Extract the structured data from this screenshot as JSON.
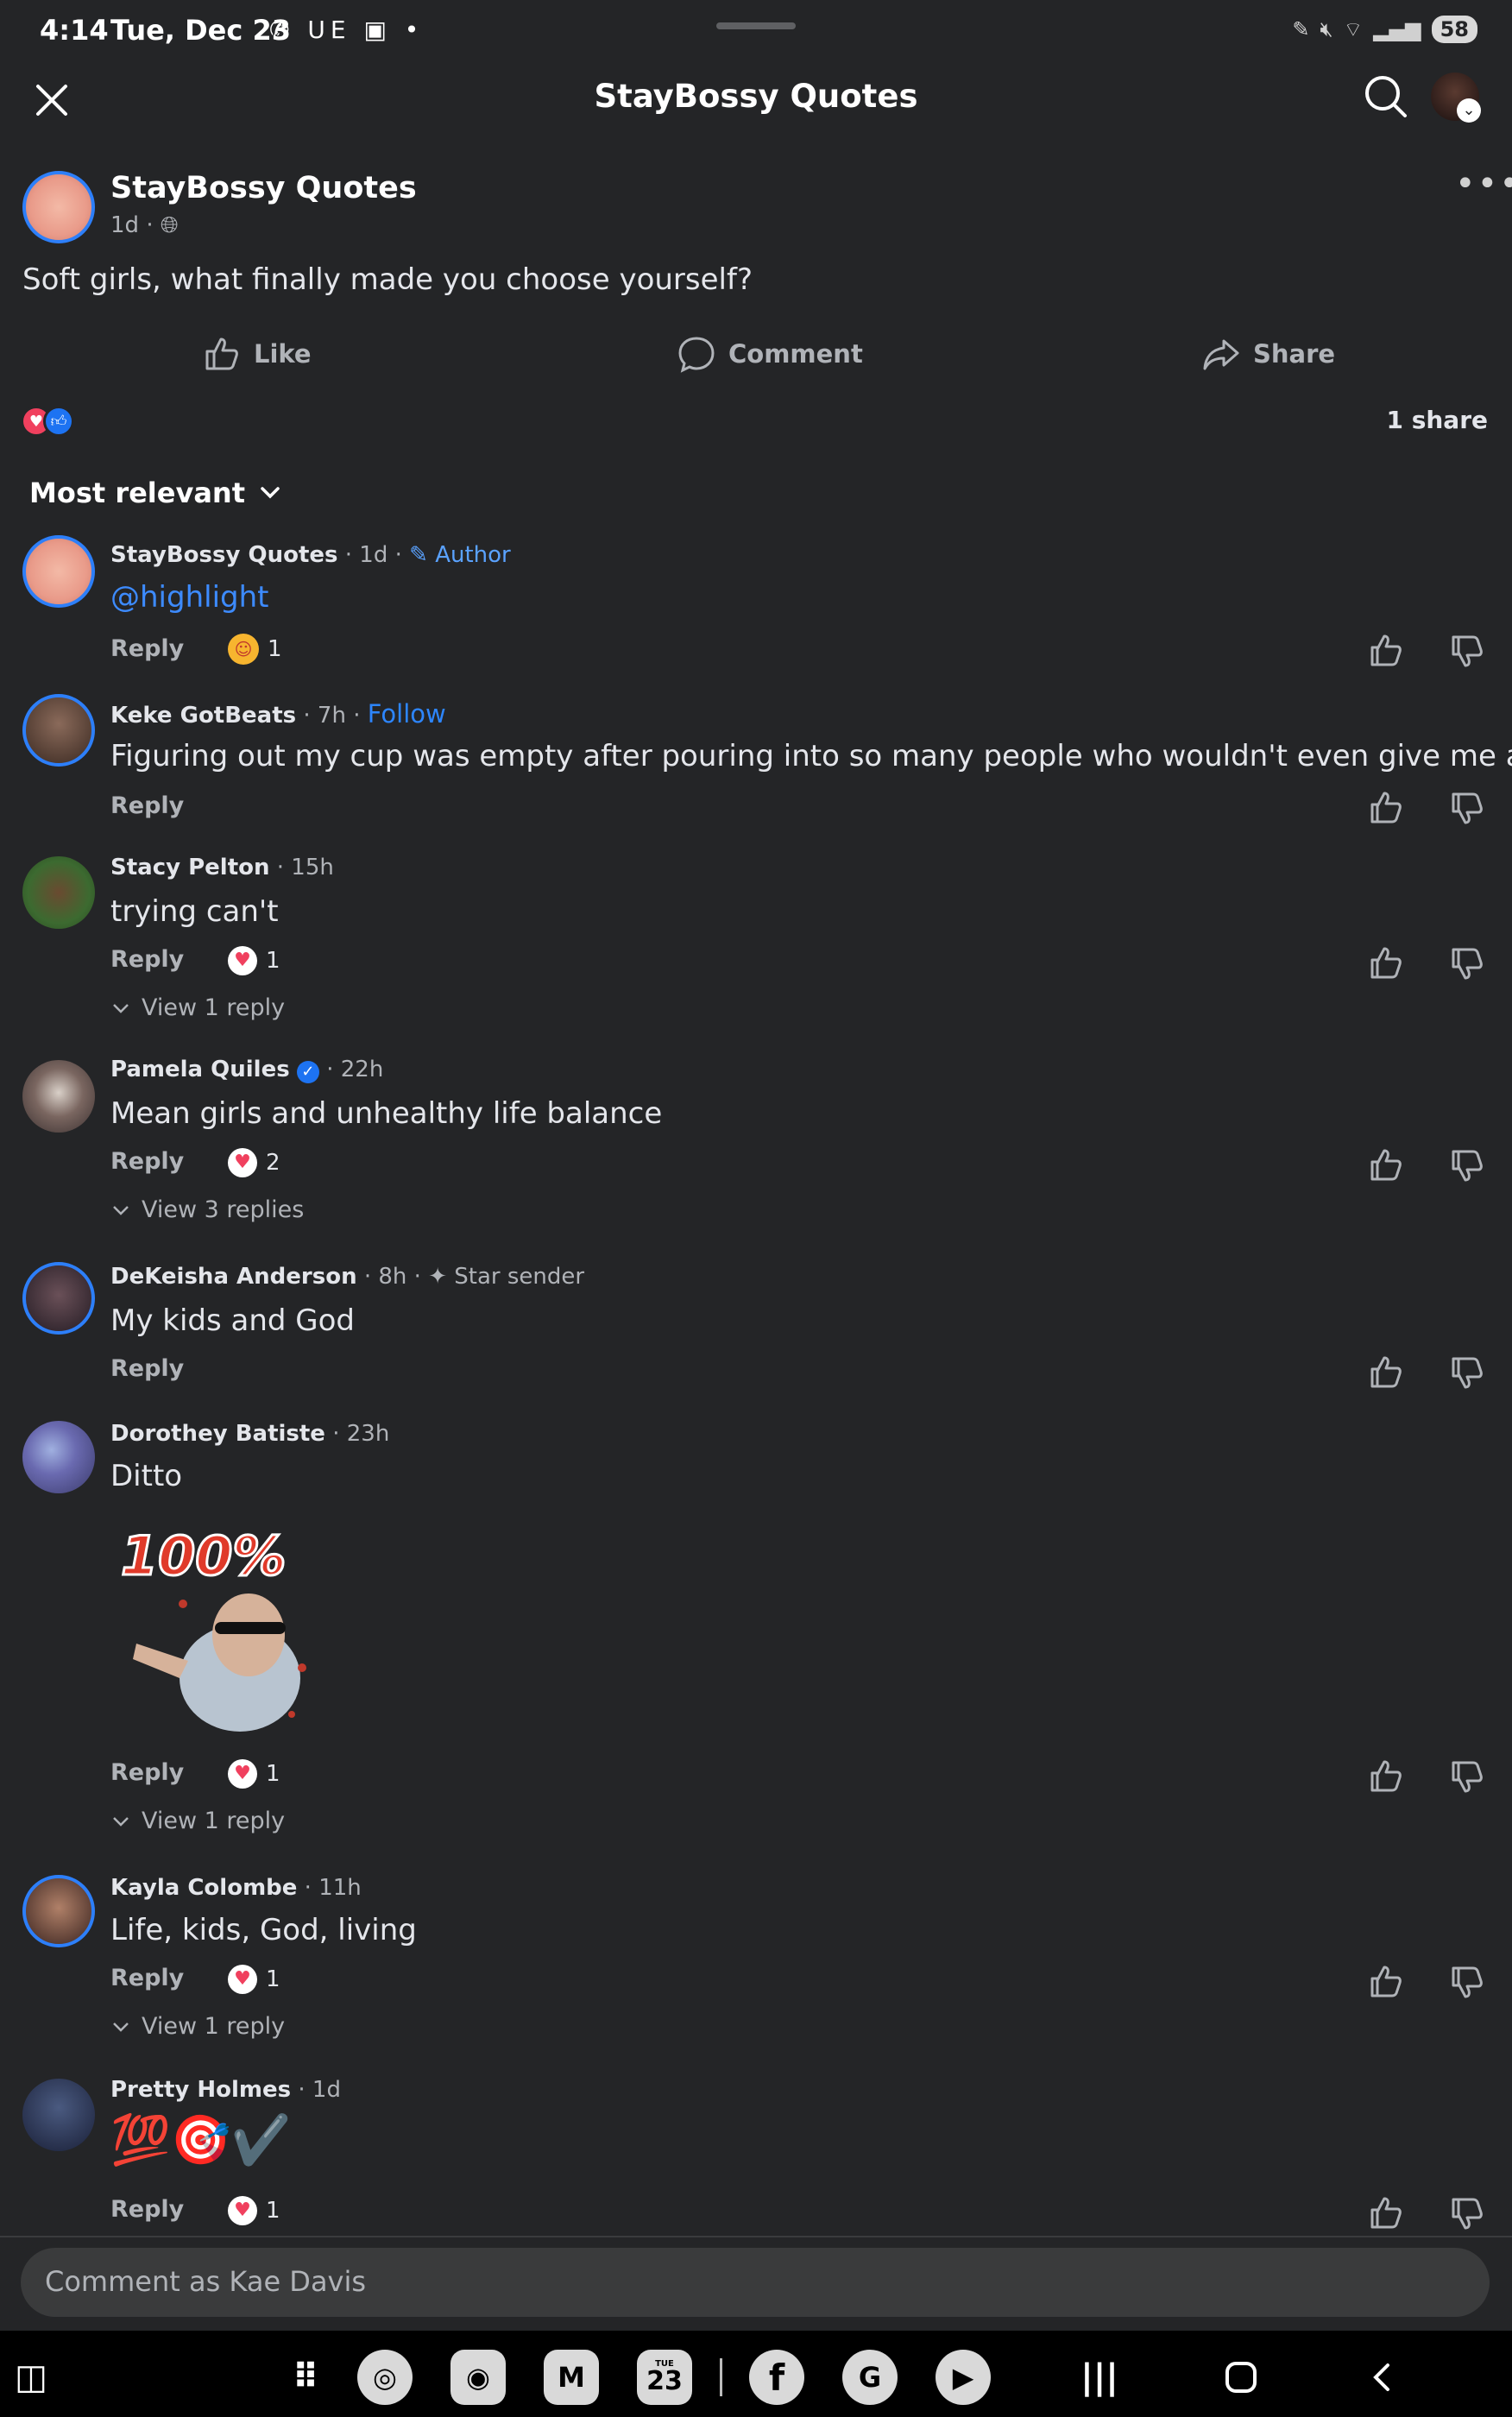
{
  "status_bar": {
    "time": "4:14",
    "date": "Tue, Dec 23",
    "left_icons": "✆ UE ▣ •",
    "battery": "58"
  },
  "header": {
    "title": "StayBossy Quotes"
  },
  "post": {
    "author": "StayBossy Quotes",
    "time": "1d",
    "privacy_icon": "globe-icon",
    "text": "Soft girls, what finally made you choose yourself?",
    "actions": {
      "like": "Like",
      "comment": "Comment",
      "share": "Share"
    },
    "shares": "1 share"
  },
  "sort": {
    "label": "Most relevant"
  },
  "comments": [
    {
      "name": "StayBossy Quotes",
      "meta": " · 1d · ",
      "badge": "Author",
      "text": "@highlight",
      "reply": "Reply",
      "reaction_count": "1"
    },
    {
      "name": "Keke GotBeats",
      "meta": " · 7h · ",
      "follow": "Follow",
      "text": "Figuring out my cup was empty after pouring into so many people who wouldn't even give me a sip.",
      "reply": "Reply"
    },
    {
      "name": "Stacy Pelton",
      "meta": " · 15h",
      "text": "trying can't",
      "reply": "Reply",
      "reaction_count": "1",
      "view_replies": "View 1 reply"
    },
    {
      "name": "Pamela Quiles",
      "meta": " · 22h",
      "text": "Mean girls and unhealthy life balance",
      "reply": "Reply",
      "reaction_count": "2",
      "view_replies": "View 3 replies"
    },
    {
      "name": "DeKeisha Anderson",
      "meta": " · 8h · ",
      "badge": "Star sender",
      "text": "My kids and God",
      "reply": "Reply"
    },
    {
      "name": "Dorothey Batiste",
      "meta": " · 23h",
      "text": "Ditto",
      "sticker_text": "100%",
      "reply": "Reply",
      "reaction_count": "1",
      "view_replies": "View 1 reply"
    },
    {
      "name": "Kayla Colombe",
      "meta": " · 11h",
      "text": "Life, kids, God, living",
      "reply": "Reply",
      "reaction_count": "1",
      "view_replies": "View 1 reply"
    },
    {
      "name": "Pretty Holmes",
      "meta": " · 1d",
      "text": "💯🎯✔️",
      "reply": "Reply",
      "reaction_count": "1"
    }
  ],
  "composer": {
    "placeholder": "Comment as Kae Davis"
  },
  "navbar": {
    "calendar_day": "23",
    "calendar_dow": "TUE"
  },
  "colors": {
    "background": "#242527",
    "accent_blue": "#2d7ff9",
    "love_red": "#f0405e"
  }
}
